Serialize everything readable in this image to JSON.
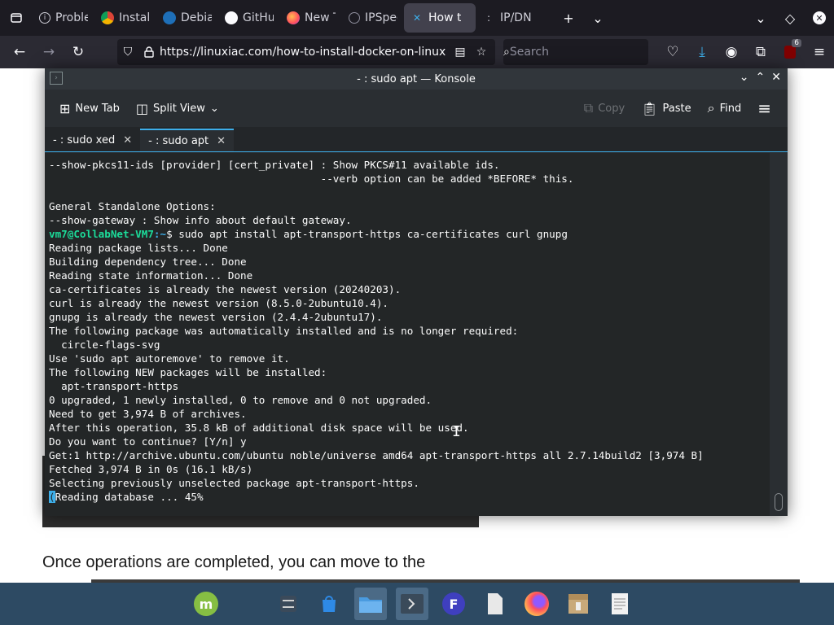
{
  "browser": {
    "tabs": [
      {
        "label": "Problem",
        "icon": "info-icon",
        "active": false
      },
      {
        "label": "Install S",
        "icon": "chrome-like-icon",
        "active": false
      },
      {
        "label": "Debian",
        "icon": "debian-icon",
        "active": false
      },
      {
        "label": "GitHub",
        "icon": "github-icon",
        "active": false
      },
      {
        "label": "New Ta",
        "icon": "firefox-icon",
        "active": false
      },
      {
        "label": "IPSpee",
        "icon": "speed-icon",
        "active": false
      },
      {
        "label": "How t",
        "icon": "linuxiac-icon",
        "active": true
      },
      {
        "label": "IP/DNS",
        "icon": "dns-icon",
        "active": false
      }
    ],
    "url": "https://linuxiac.com/how-to-install-docker-on-linux",
    "search_placeholder": "Search",
    "extension_badge": "6"
  },
  "page": {
    "visible_text": "Once operations are completed, you can move to the"
  },
  "konsole": {
    "window_title": "- : sudo apt — Konsole",
    "toolbar": {
      "new_tab": "New Tab",
      "split_view": "Split View",
      "copy": "Copy",
      "paste": "Paste",
      "find": "Find"
    },
    "tabs": [
      {
        "label": "- : sudo xed",
        "active": false
      },
      {
        "label": "- : sudo apt",
        "active": true
      }
    ],
    "terminal": {
      "lines_before": "--show-pkcs11-ids [provider] [cert_private] : Show PKCS#11 available ids.\n                                            --verb option can be added *BEFORE* this.\n\nGeneral Standalone Options:\n--show-gateway : Show info about default gateway.",
      "prompt_user": "vm7@CollabNet-VM7",
      "prompt_path": ":~",
      "command": "$ sudo apt install apt-transport-https ca-certificates curl gnupg",
      "lines_after": "Reading package lists... Done\nBuilding dependency tree... Done\nReading state information... Done\nca-certificates is already the newest version (20240203).\ncurl is already the newest version (8.5.0-2ubuntu10.4).\ngnupg is already the newest version (2.4.4-2ubuntu17).\nThe following package was automatically installed and is no longer required:\n  circle-flags-svg\nUse 'sudo apt autoremove' to remove it.\nThe following NEW packages will be installed:\n  apt-transport-https\n0 upgraded, 1 newly installed, 0 to remove and 0 not upgraded.\nNeed to get 3,974 B of archives.\nAfter this operation, 35.8 kB of additional disk space will be used.\nDo you want to continue? [Y/n] y\nGet:1 http://archive.ubuntu.com/ubuntu noble/universe amd64 apt-transport-https all 2.7.14build2 [3,974 B]\nFetched 3,974 B in 0s (16.1 kB/s)\nSelecting previously unselected package apt-transport-https.",
      "cursor_char": "(",
      "last_line": "Reading database ... 45%"
    }
  },
  "taskbar": {
    "items": [
      "linux-mint-menu-icon",
      "settings-icon",
      "software-store-icon",
      "files-icon",
      "terminal-icon",
      "fluent-icon",
      "blank-doc-icon",
      "firefox-icon",
      "archive-icon",
      "text-editor-icon"
    ]
  },
  "colors": {
    "prompt_user": "#1cdc9a",
    "prompt_path": "#3daee9",
    "accent": "#3daee9"
  }
}
